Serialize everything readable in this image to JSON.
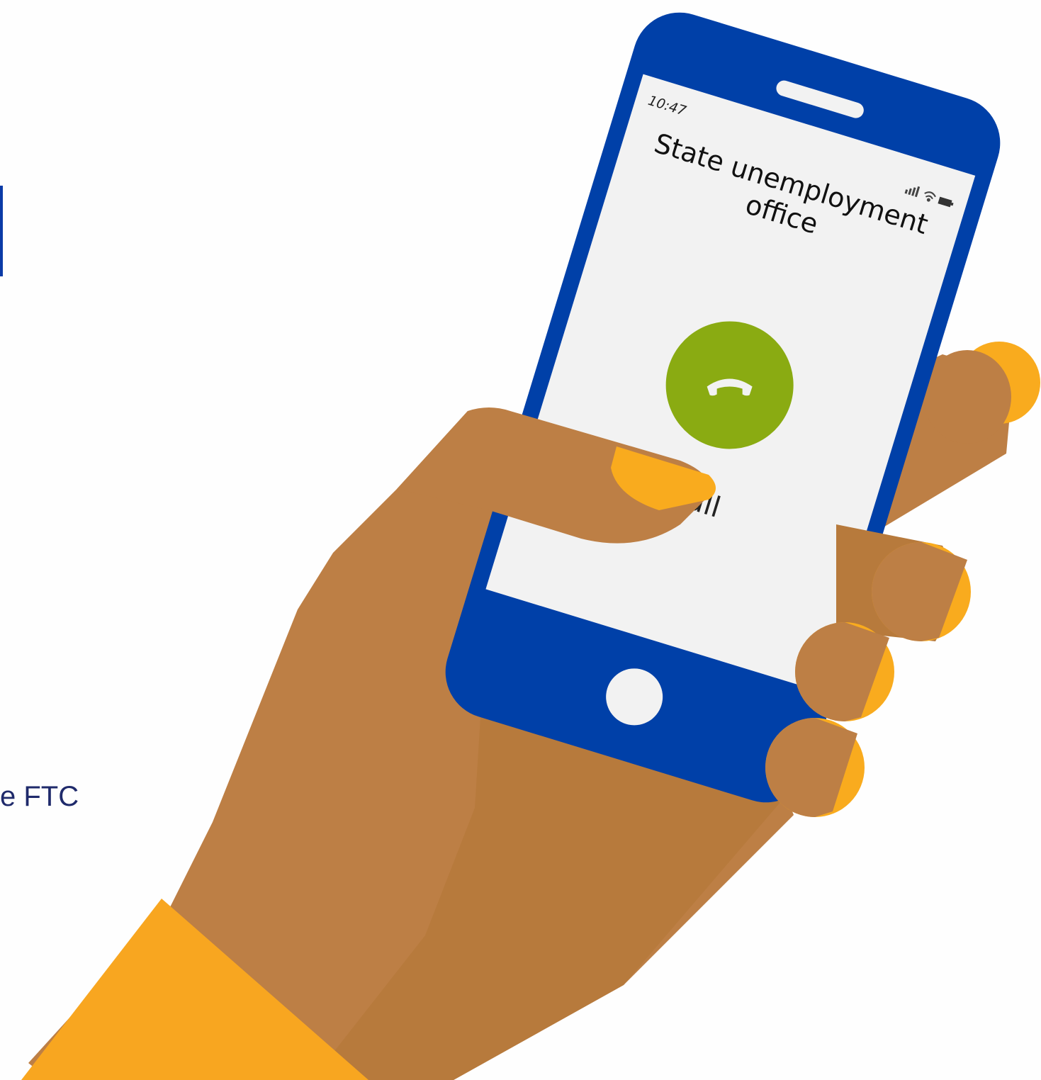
{
  "page": {
    "edge_text": "e FTC"
  },
  "phone": {
    "status_time": "10:47",
    "contact_line1": "State unemployment",
    "contact_line2": "office",
    "call_label": "Call",
    "call_button_icon": "phone-handset-icon",
    "signal_icon": "signal-icon",
    "wifi_icon": "wifi-icon",
    "battery_icon": "battery-icon",
    "home_button_icon": "home-button-icon"
  },
  "colors": {
    "phone_body": "#0040a8",
    "screen": "#f2f2f2",
    "call_button": "#8aab12",
    "skin": "#bd7f45",
    "skin_shadow": "#b77a3c",
    "fingernail": "#f9ab1e",
    "sleeve": "#f8a620",
    "edge_text": "#1f2a6b"
  }
}
